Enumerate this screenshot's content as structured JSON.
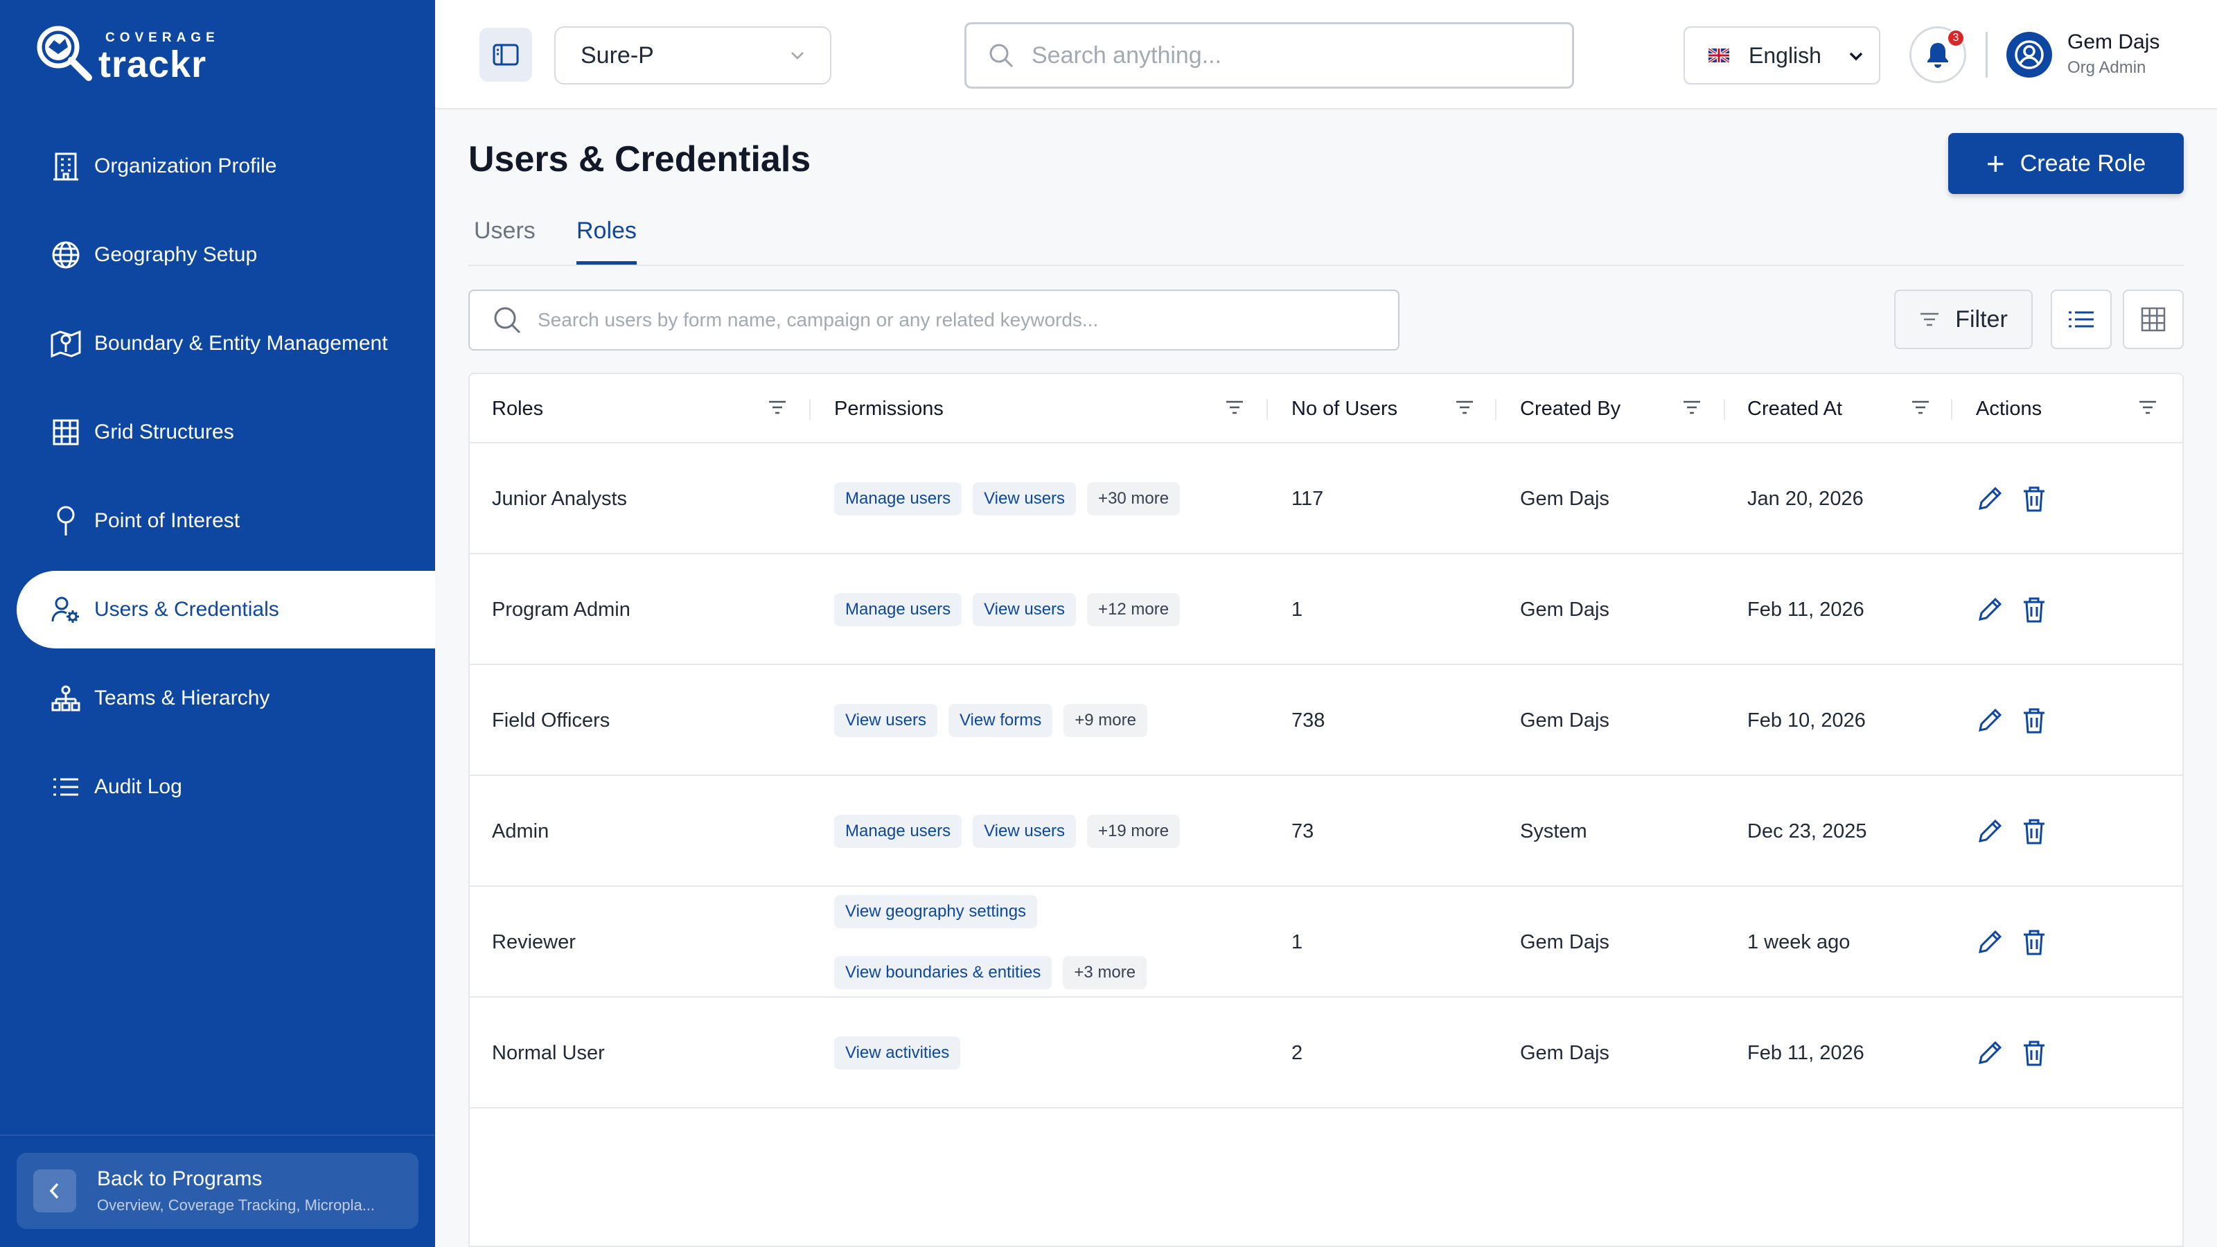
{
  "brand": {
    "small": "COVERAGE",
    "big": "trackr"
  },
  "sidebar": {
    "items": [
      {
        "label": "Organization Profile",
        "icon": "building-icon",
        "active": false
      },
      {
        "label": "Geography Setup",
        "icon": "globe-icon",
        "active": false
      },
      {
        "label": "Boundary & Entity Management",
        "icon": "map-pin-icon",
        "active": false
      },
      {
        "label": "Grid Structures",
        "icon": "grid-icon",
        "active": false
      },
      {
        "label": "Point of Interest",
        "icon": "location-pin-icon",
        "active": false
      },
      {
        "label": "Users & Credentials",
        "icon": "user-gear-icon",
        "active": true
      },
      {
        "label": "Teams & Hierarchy",
        "icon": "hierarchy-icon",
        "active": false
      },
      {
        "label": "Audit Log",
        "icon": "list-icon",
        "active": false
      }
    ],
    "back": {
      "title": "Back to Programs",
      "subtitle": "Overview, Coverage Tracking, Micropla..."
    }
  },
  "header": {
    "program": "Sure-P",
    "search_placeholder": "Search anything...",
    "language": "English",
    "notification_count": "3",
    "user_name": "Gem Dajs",
    "user_role": "Org Admin"
  },
  "page": {
    "title": "Users & Credentials",
    "create_label": "Create Role",
    "tabs": [
      {
        "label": "Users",
        "active": false
      },
      {
        "label": "Roles",
        "active": true
      }
    ],
    "list_search_placeholder": "Search users by form name, campaign or any related keywords...",
    "filter_label": "Filter"
  },
  "table": {
    "columns": [
      "Roles",
      "Permissions",
      "No of Users",
      "Created By",
      "Created At",
      "Actions"
    ],
    "rows": [
      {
        "role": "Junior Analysts",
        "permissions": [
          "Manage users",
          "View users"
        ],
        "more": "+30 more",
        "users": "117",
        "created_by": "Gem Dajs",
        "created_at": "Jan 20, 2026"
      },
      {
        "role": "Program Admin",
        "permissions": [
          "Manage users",
          "View users"
        ],
        "more": "+12 more",
        "users": "1",
        "created_by": "Gem Dajs",
        "created_at": "Feb 11, 2026"
      },
      {
        "role": "Field Officers",
        "permissions": [
          "View users",
          "View forms"
        ],
        "more": "+9 more",
        "users": "738",
        "created_by": "Gem Dajs",
        "created_at": "Feb 10, 2026"
      },
      {
        "role": "Admin",
        "permissions": [
          "Manage users",
          "View users"
        ],
        "more": "+19 more",
        "users": "73",
        "created_by": "System",
        "created_at": "Dec 23, 2025"
      },
      {
        "role": "Reviewer",
        "permissions": [
          "View geography settings",
          "View boundaries & entities"
        ],
        "more": "+3 more",
        "users": "1",
        "created_by": "Gem Dajs",
        "created_at": "1 week ago"
      },
      {
        "role": "Normal User",
        "permissions": [
          "View activities"
        ],
        "more": "",
        "users": "2",
        "created_by": "Gem Dajs",
        "created_at": "Feb 11, 2026"
      }
    ]
  }
}
